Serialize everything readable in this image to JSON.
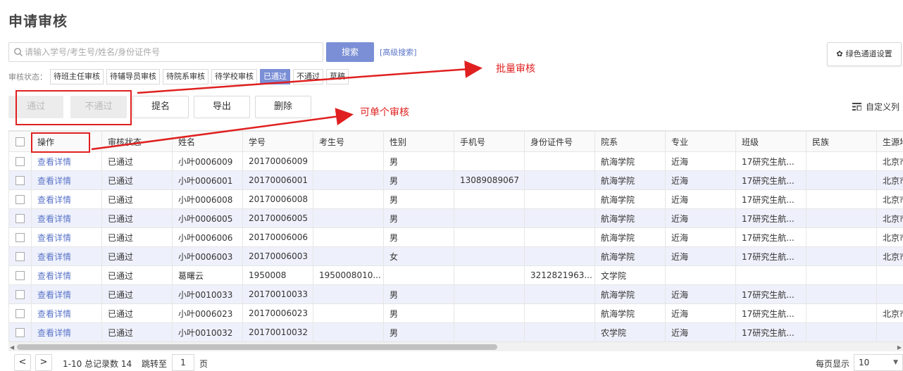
{
  "page_title": "申请审核",
  "search": {
    "placeholder": "请输入学号/考生号/姓名/身份证件号",
    "value": "",
    "button_label": "搜索",
    "advanced_label": "[高级搜索]"
  },
  "green_channel_label": "绿色通道设置",
  "status_filter": {
    "label": "审核状态：",
    "tags": [
      {
        "label": "待班主任审核"
      },
      {
        "label": "待辅导员审核"
      },
      {
        "label": "待院系审核"
      },
      {
        "label": "待学校审核"
      },
      {
        "label": "已通过"
      },
      {
        "label": "不通过"
      },
      {
        "label": "草稿"
      }
    ],
    "active": "已通过"
  },
  "actions": {
    "pass": "通过",
    "reject": "不通过",
    "nominate": "提名",
    "export": "导出",
    "delete": "删除"
  },
  "custom_columns_label": "自定义列",
  "table": {
    "headers": [
      "操作",
      "审核状态",
      "姓名",
      "学号",
      "考生号",
      "性别",
      "手机号",
      "身份证件号",
      "院系",
      "专业",
      "班级",
      "民族",
      "生源地"
    ],
    "rows": [
      {
        "op": "查看详情",
        "status": "已通过",
        "name": "小叶0006009",
        "sid": "20170006009",
        "exam": "",
        "gender": "男",
        "phone": "",
        "idno": "",
        "dept": "航海学院",
        "major": "近海",
        "class": "17研究生航...",
        "nation": "",
        "origin": "北京市"
      },
      {
        "op": "查看详情",
        "status": "已通过",
        "name": "小叶0006001",
        "sid": "20170006001",
        "exam": "",
        "gender": "男",
        "phone": "13089089067",
        "idno": "",
        "dept": "航海学院",
        "major": "近海",
        "class": "17研究生航...",
        "nation": "",
        "origin": "北京市"
      },
      {
        "op": "查看详情",
        "status": "已通过",
        "name": "小叶0006008",
        "sid": "20170006008",
        "exam": "",
        "gender": "男",
        "phone": "",
        "idno": "",
        "dept": "航海学院",
        "major": "近海",
        "class": "17研究生航...",
        "nation": "",
        "origin": "北京市"
      },
      {
        "op": "查看详情",
        "status": "已通过",
        "name": "小叶0006005",
        "sid": "20170006005",
        "exam": "",
        "gender": "男",
        "phone": "",
        "idno": "",
        "dept": "航海学院",
        "major": "近海",
        "class": "17研究生航...",
        "nation": "",
        "origin": "北京市"
      },
      {
        "op": "查看详情",
        "status": "已通过",
        "name": "小叶0006006",
        "sid": "20170006006",
        "exam": "",
        "gender": "男",
        "phone": "",
        "idno": "",
        "dept": "航海学院",
        "major": "近海",
        "class": "17研究生航...",
        "nation": "",
        "origin": "北京市"
      },
      {
        "op": "查看详情",
        "status": "已通过",
        "name": "小叶0006003",
        "sid": "20170006003",
        "exam": "",
        "gender": "女",
        "phone": "",
        "idno": "",
        "dept": "航海学院",
        "major": "近海",
        "class": "17研究生航...",
        "nation": "",
        "origin": "北京市"
      },
      {
        "op": "查看详情",
        "status": "已通过",
        "name": "葛曙云",
        "sid": "1950008",
        "exam": "1950008010...",
        "gender": "",
        "phone": "",
        "idno": "3212821963...",
        "dept": "文学院",
        "major": "",
        "class": "",
        "nation": "",
        "origin": ""
      },
      {
        "op": "查看详情",
        "status": "已通过",
        "name": "小叶0010033",
        "sid": "20170010033",
        "exam": "",
        "gender": "男",
        "phone": "",
        "idno": "",
        "dept": "航海学院",
        "major": "近海",
        "class": "17研究生航...",
        "nation": "",
        "origin": ""
      },
      {
        "op": "查看详情",
        "status": "已通过",
        "name": "小叶0006023",
        "sid": "20170006023",
        "exam": "",
        "gender": "男",
        "phone": "",
        "idno": "",
        "dept": "航海学院",
        "major": "近海",
        "class": "17研究生航...",
        "nation": "",
        "origin": "北京市"
      },
      {
        "op": "查看详情",
        "status": "已通过",
        "name": "小叶0010032",
        "sid": "20170010032",
        "exam": "",
        "gender": "男",
        "phone": "",
        "idno": "",
        "dept": "农学院",
        "major": "近海",
        "class": "17研究生航...",
        "nation": "",
        "origin": ""
      }
    ]
  },
  "pager": {
    "prev": "<",
    "next": ">",
    "summary": "1-10 总记录数 14",
    "goto_label": "跳转至",
    "goto_value": "1",
    "page_unit": "页",
    "size_label": "每页显示",
    "size_value": "10"
  },
  "annotations": {
    "batch": "批量审核",
    "single": "可单个审核",
    "color": "#e02020"
  }
}
